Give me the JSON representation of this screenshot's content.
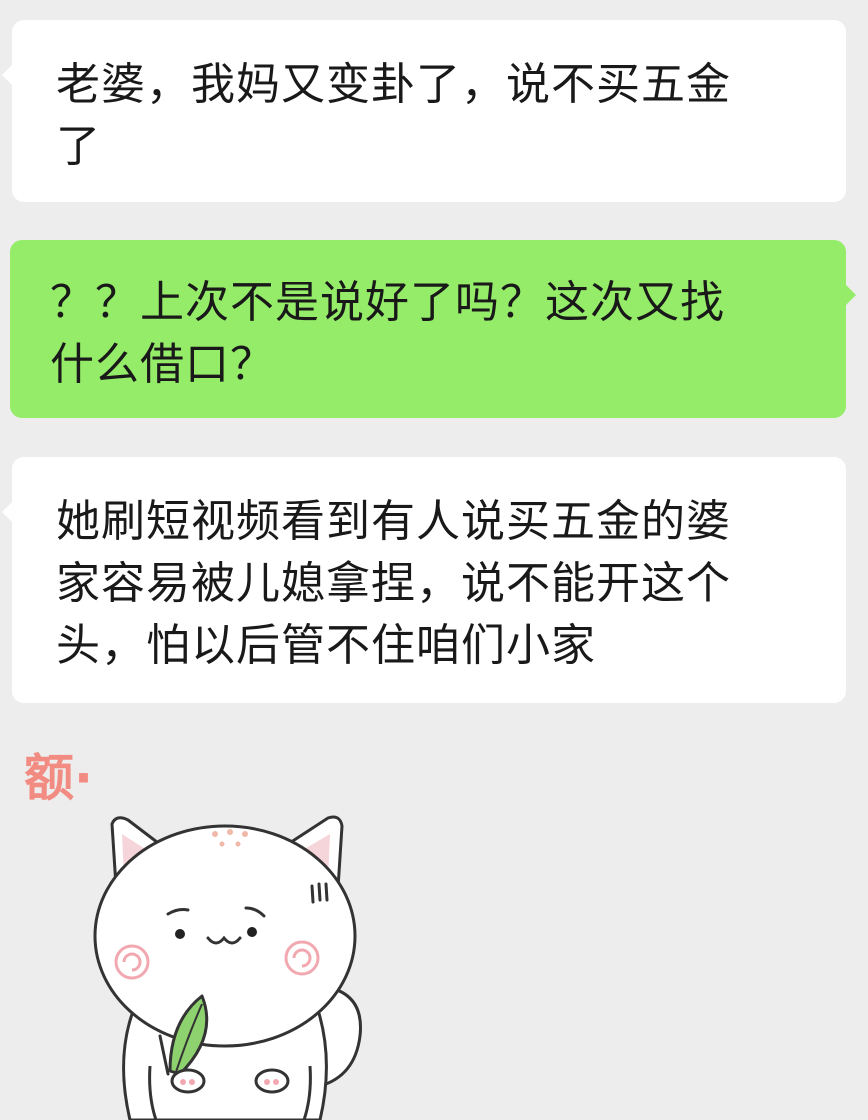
{
  "messages": [
    {
      "id": "msg1",
      "side": "left",
      "lines": [
        "老婆，我妈又变卦了，说不买五金",
        "了"
      ]
    },
    {
      "id": "msg2",
      "side": "right",
      "lines": [
        "？？上次不是说好了吗？这次又找",
        "什么借口？"
      ]
    },
    {
      "id": "msg3",
      "side": "left",
      "lines": [
        "她刷短视频看到有人说买五金的婆",
        "家容易被儿媳拿捏，说不能开这个",
        "头，怕以后管不住咱们小家"
      ]
    }
  ],
  "sticker": {
    "caption": "额·",
    "icon": "white-cat-holding-leaf-sticker"
  },
  "colors": {
    "background": "#ededed",
    "incoming_bubble": "#ffffff",
    "outgoing_bubble": "#95ec69",
    "text": "#191919",
    "sticker_caption": "#f28b82"
  }
}
